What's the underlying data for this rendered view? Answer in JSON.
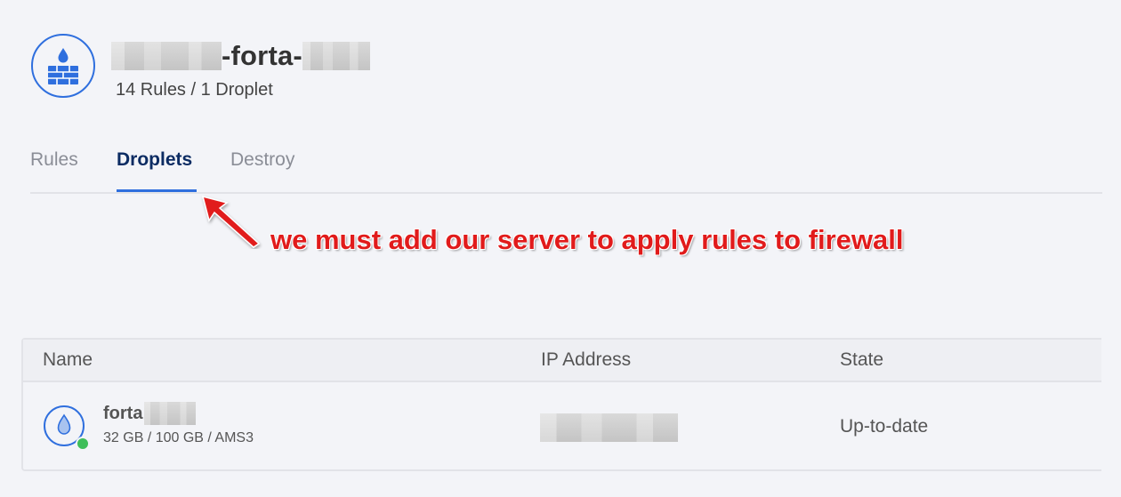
{
  "header": {
    "title_visible": "-forta-",
    "subtitle": "14 Rules / 1 Droplet"
  },
  "tabs": [
    {
      "label": "Rules",
      "active": false
    },
    {
      "label": "Droplets",
      "active": true
    },
    {
      "label": "Destroy",
      "active": false
    }
  ],
  "annotation": {
    "text": "we must add our server to apply rules to firewall",
    "color": "#e11b1b"
  },
  "table": {
    "columns": [
      "Name",
      "IP Address",
      "State"
    ],
    "rows": [
      {
        "name_visible": "forta",
        "meta": "32 GB / 100 GB / AMS3",
        "state": "Up-to-date",
        "status": "online"
      }
    ]
  },
  "icons": {
    "header": "firewall-icon",
    "row": "droplet-icon"
  },
  "colors": {
    "accent": "#2f6fde",
    "active_tab": "#0c2c63",
    "status_online": "#3fbe5a"
  }
}
